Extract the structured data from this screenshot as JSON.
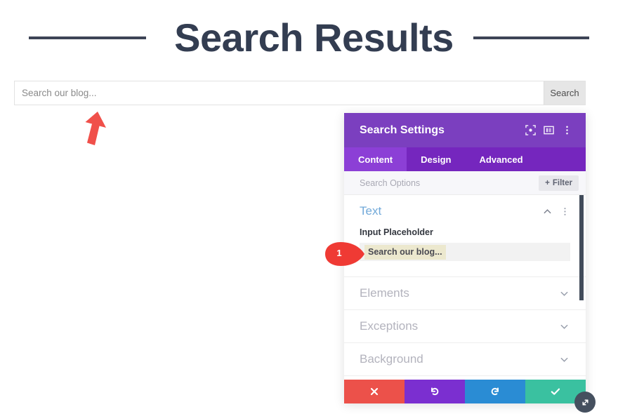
{
  "page": {
    "title": "Search Results"
  },
  "search_form": {
    "placeholder": "Search our blog...",
    "value": "",
    "submit_label": "Search"
  },
  "annotations": {
    "arrow_color": "#f0504a",
    "callout_1": "1"
  },
  "settings_panel": {
    "title": "Search Settings",
    "header_icons": [
      {
        "name": "focus-icon"
      },
      {
        "name": "layout-icon"
      },
      {
        "name": "more-options-icon"
      }
    ],
    "tabs": [
      {
        "label": "Content",
        "active": true
      },
      {
        "label": "Design",
        "active": false
      },
      {
        "label": "Advanced",
        "active": false
      }
    ],
    "filter_row": {
      "placeholder": "Search Options",
      "button_label": "Filter",
      "button_plus": "+"
    },
    "sections": [
      {
        "name": "Text",
        "state": "open",
        "field_label": "Input Placeholder",
        "field_value": "Search our blog..."
      },
      {
        "name": "Elements",
        "state": "closed"
      },
      {
        "name": "Exceptions",
        "state": "closed"
      },
      {
        "name": "Background",
        "state": "closed"
      }
    ],
    "footer": [
      {
        "name": "cancel",
        "glyph": "✖",
        "color": "#ec514a"
      },
      {
        "name": "undo",
        "glyph": "↺",
        "color": "#7b2fd0"
      },
      {
        "name": "redo",
        "glyph": "↻",
        "color": "#2a8cd4"
      },
      {
        "name": "save",
        "glyph": "✔",
        "color": "#3ac1a0"
      }
    ],
    "colors": {
      "header": "#7b3fbf",
      "tabbar": "#7526be",
      "tab_active": "#8c3fd6",
      "section_open_text": "#71a9d9",
      "highlight": "#ece8ce"
    }
  }
}
